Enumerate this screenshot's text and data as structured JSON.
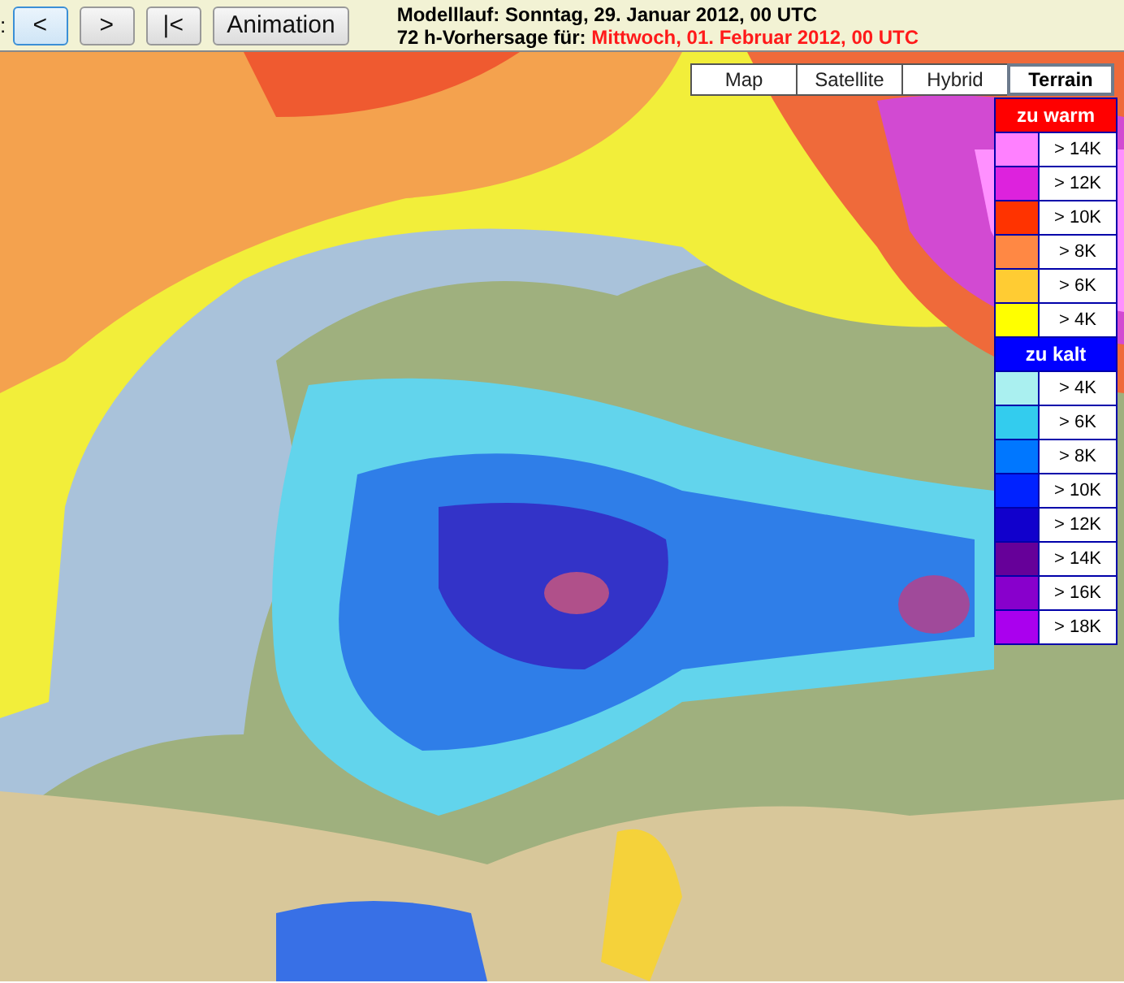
{
  "partial_label": ":",
  "nav_buttons": [
    {
      "label": "<",
      "focused": true
    },
    {
      "label": ">",
      "focused": false
    },
    {
      "label": "|<",
      "focused": false
    },
    {
      "label": "Animation",
      "focused": false
    }
  ],
  "run_info": "Modelllauf: Sonntag, 29. Januar 2012, 00 UTC",
  "forecast": {
    "label": "72 h-Vorhersage für:",
    "value": "Mittwoch, 01. Februar 2012, 00 UTC"
  },
  "map_types": [
    {
      "label": "Map",
      "selected": false
    },
    {
      "label": "Satellite",
      "selected": false
    },
    {
      "label": "Hybrid",
      "selected": false
    },
    {
      "label": "Terrain",
      "selected": true
    }
  ],
  "legend": [
    {
      "title": "zu warm",
      "color": "#ff0000",
      "items": [
        {
          "label": "> 14K",
          "color": "#ff80ff"
        },
        {
          "label": "> 12K",
          "color": "#dd22dd"
        },
        {
          "label": "> 10K",
          "color": "#ff3300"
        },
        {
          "label": "> 8K",
          "color": "#ff8844"
        },
        {
          "label": "> 6K",
          "color": "#ffcc33"
        },
        {
          "label": "> 4K",
          "color": "#ffff00"
        }
      ]
    },
    {
      "title": "zu kalt",
      "color": "#0000ff",
      "items": [
        {
          "label": "> 4K",
          "color": "#aaf0f0"
        },
        {
          "label": "> 6K",
          "color": "#33ccee"
        },
        {
          "label": "> 8K",
          "color": "#0077ff"
        },
        {
          "label": "> 10K",
          "color": "#0022ff"
        },
        {
          "label": "> 12K",
          "color": "#1100cc"
        },
        {
          "label": "> 14K",
          "color": "#660099"
        },
        {
          "label": "> 16K",
          "color": "#8800cc"
        },
        {
          "label": "> 18K",
          "color": "#aa00ee"
        }
      ]
    }
  ]
}
